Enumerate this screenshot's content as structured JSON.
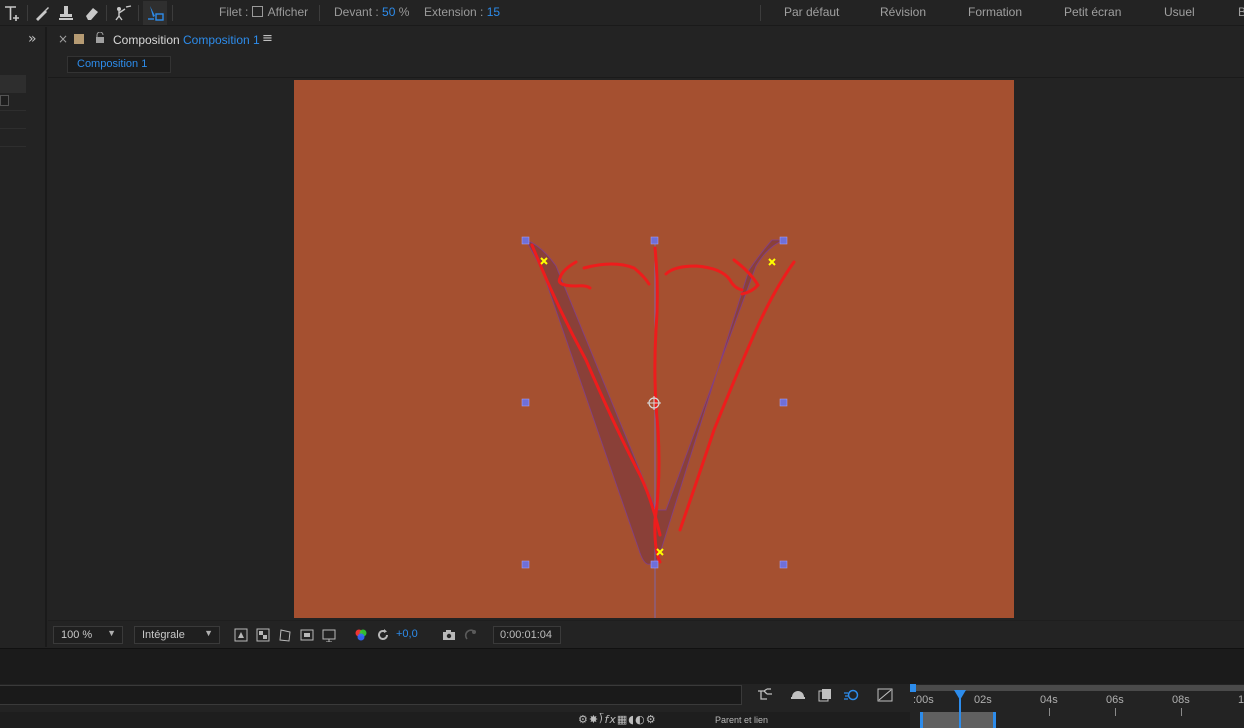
{
  "toolbar": {
    "tools": [
      "text-tool-icon",
      "brush-tool-icon",
      "clone-stamp-tool-icon",
      "eraser-tool-icon",
      "roto-brush-tool-icon",
      "puppet-pin-tool-icon"
    ],
    "filet_label": "Filet :",
    "afficher_label": "Afficher",
    "devant_label": "Devant :",
    "devant_value": "50",
    "devant_unit": "%",
    "extension_label": "Extension :",
    "extension_value": "15"
  },
  "workspaces": [
    "Par défaut",
    "Révision",
    "Formation",
    "Petit écran",
    "Usuel",
    "B"
  ],
  "panel": {
    "expand_icon": "»",
    "close_icon": "×",
    "title_prefix": "Composition",
    "title_name": "Composition 1",
    "menu_icon": "≡",
    "tab_label": "Composition 1"
  },
  "canvas": {
    "background": "#a55030",
    "shape_fill": "#8a4038",
    "stroke_color": "#ee1c1c",
    "handle_color": "#6f6fd8",
    "pin_color": "#ffff00"
  },
  "viewer_bar": {
    "zoom": "100 %",
    "resolution": "Intégrale",
    "exposure": "+0,0",
    "timecode": "0:00:01:04"
  },
  "timeline": {
    "column_labels": [
      "Parent et lien"
    ],
    "ruler_labels": [
      ":00s",
      "02s",
      "04s",
      "06s",
      "08s",
      "1"
    ]
  }
}
